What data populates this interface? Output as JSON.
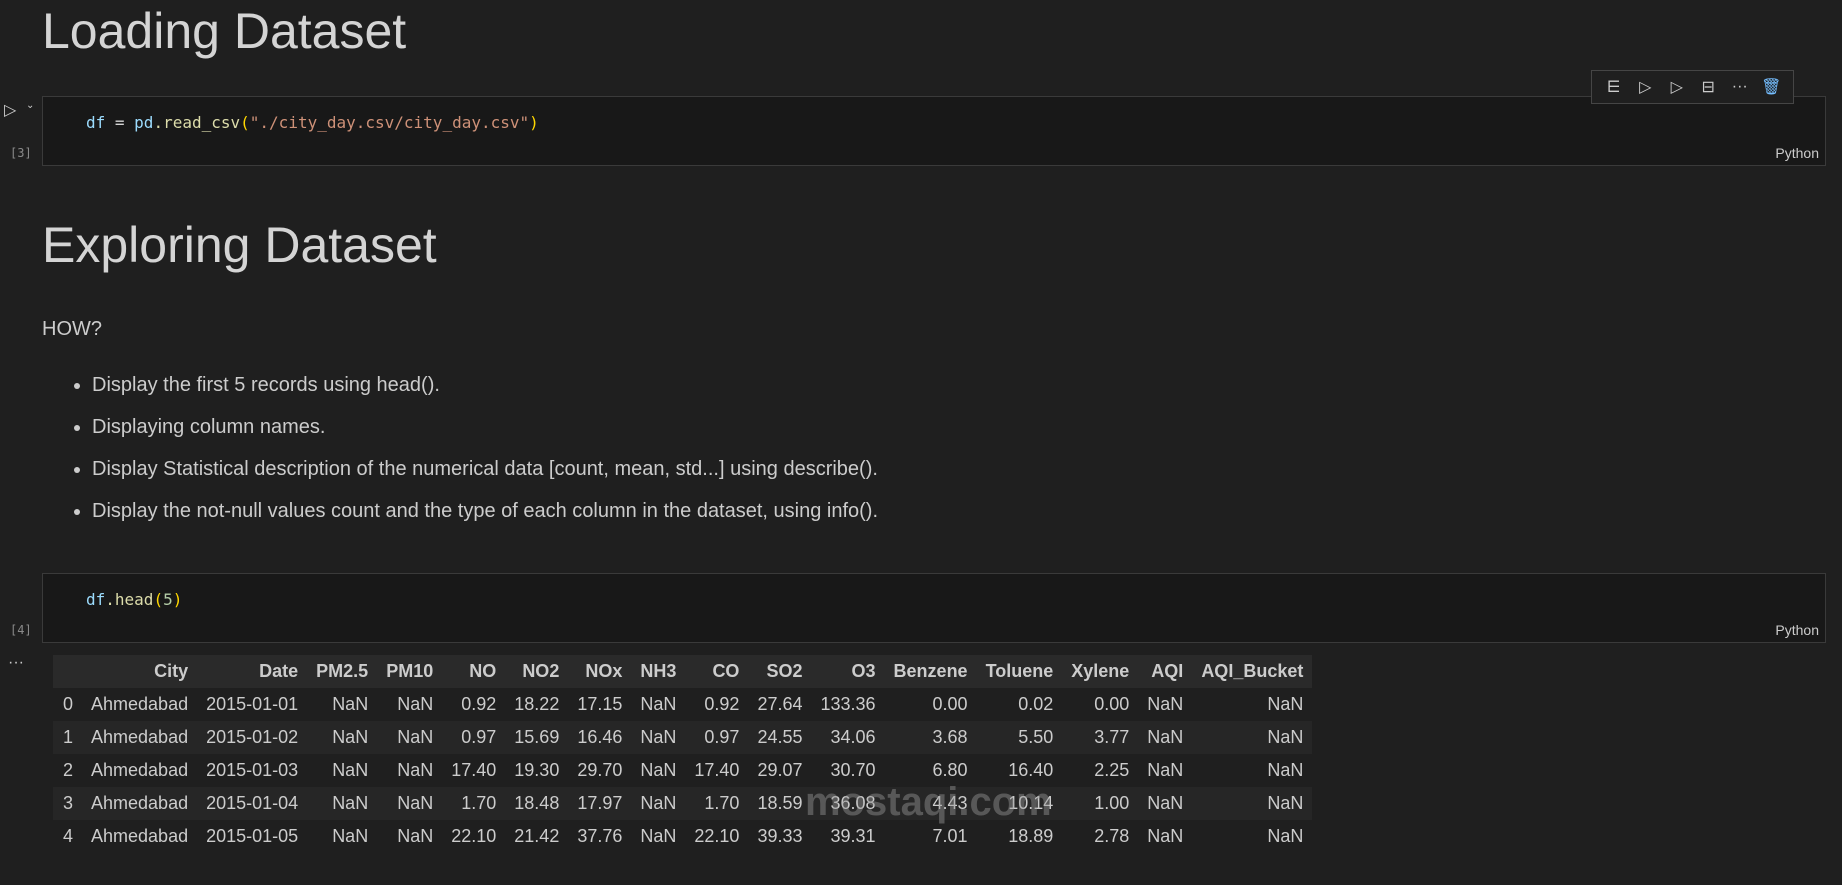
{
  "headings": {
    "loading": "Loading Dataset",
    "exploring": "Exploring Dataset"
  },
  "cell1": {
    "exec": "[3]",
    "lang": "Python",
    "code": {
      "var": "df",
      "eq": " = ",
      "mod": "pd",
      "fn": ".read_csv",
      "open": "(",
      "str": "\"./city_day.csv/city_day.csv\"",
      "close": ")"
    }
  },
  "toolbar": {
    "items": [
      "execute-above",
      "run-above",
      "run-below",
      "split-cell",
      "more",
      "delete"
    ],
    "more": "···"
  },
  "markdown": {
    "how": "HOW?",
    "bullets": [
      "Display the first 5 records using head().",
      "Displaying column names.",
      "Display Statistical description of the numerical data [count, mean, std...] using describe().",
      "Display the not-null values count and the type of each column in the dataset, using info()."
    ]
  },
  "cell2": {
    "exec": "[4]",
    "lang": "Python",
    "code": {
      "var": "df",
      "fn": ".head",
      "open": "(",
      "num": "5",
      "close": ")"
    }
  },
  "output": {
    "more": "···",
    "columns": [
      "",
      "City",
      "Date",
      "PM2.5",
      "PM10",
      "NO",
      "NO2",
      "NOx",
      "NH3",
      "CO",
      "SO2",
      "O3",
      "Benzene",
      "Toluene",
      "Xylene",
      "AQI",
      "AQI_Bucket"
    ],
    "rows": [
      [
        "0",
        "Ahmedabad",
        "2015-01-01",
        "NaN",
        "NaN",
        "0.92",
        "18.22",
        "17.15",
        "NaN",
        "0.92",
        "27.64",
        "133.36",
        "0.00",
        "0.02",
        "0.00",
        "NaN",
        "NaN"
      ],
      [
        "1",
        "Ahmedabad",
        "2015-01-02",
        "NaN",
        "NaN",
        "0.97",
        "15.69",
        "16.46",
        "NaN",
        "0.97",
        "24.55",
        "34.06",
        "3.68",
        "5.50",
        "3.77",
        "NaN",
        "NaN"
      ],
      [
        "2",
        "Ahmedabad",
        "2015-01-03",
        "NaN",
        "NaN",
        "17.40",
        "19.30",
        "29.70",
        "NaN",
        "17.40",
        "29.07",
        "30.70",
        "6.80",
        "16.40",
        "2.25",
        "NaN",
        "NaN"
      ],
      [
        "3",
        "Ahmedabad",
        "2015-01-04",
        "NaN",
        "NaN",
        "1.70",
        "18.48",
        "17.97",
        "NaN",
        "1.70",
        "18.59",
        "36.08",
        "4.43",
        "10.14",
        "1.00",
        "NaN",
        "NaN"
      ],
      [
        "4",
        "Ahmedabad",
        "2015-01-05",
        "NaN",
        "NaN",
        "22.10",
        "21.42",
        "37.76",
        "NaN",
        "22.10",
        "39.33",
        "39.31",
        "7.01",
        "18.89",
        "2.78",
        "NaN",
        "NaN"
      ]
    ]
  },
  "watermark": "mostaqi.com"
}
